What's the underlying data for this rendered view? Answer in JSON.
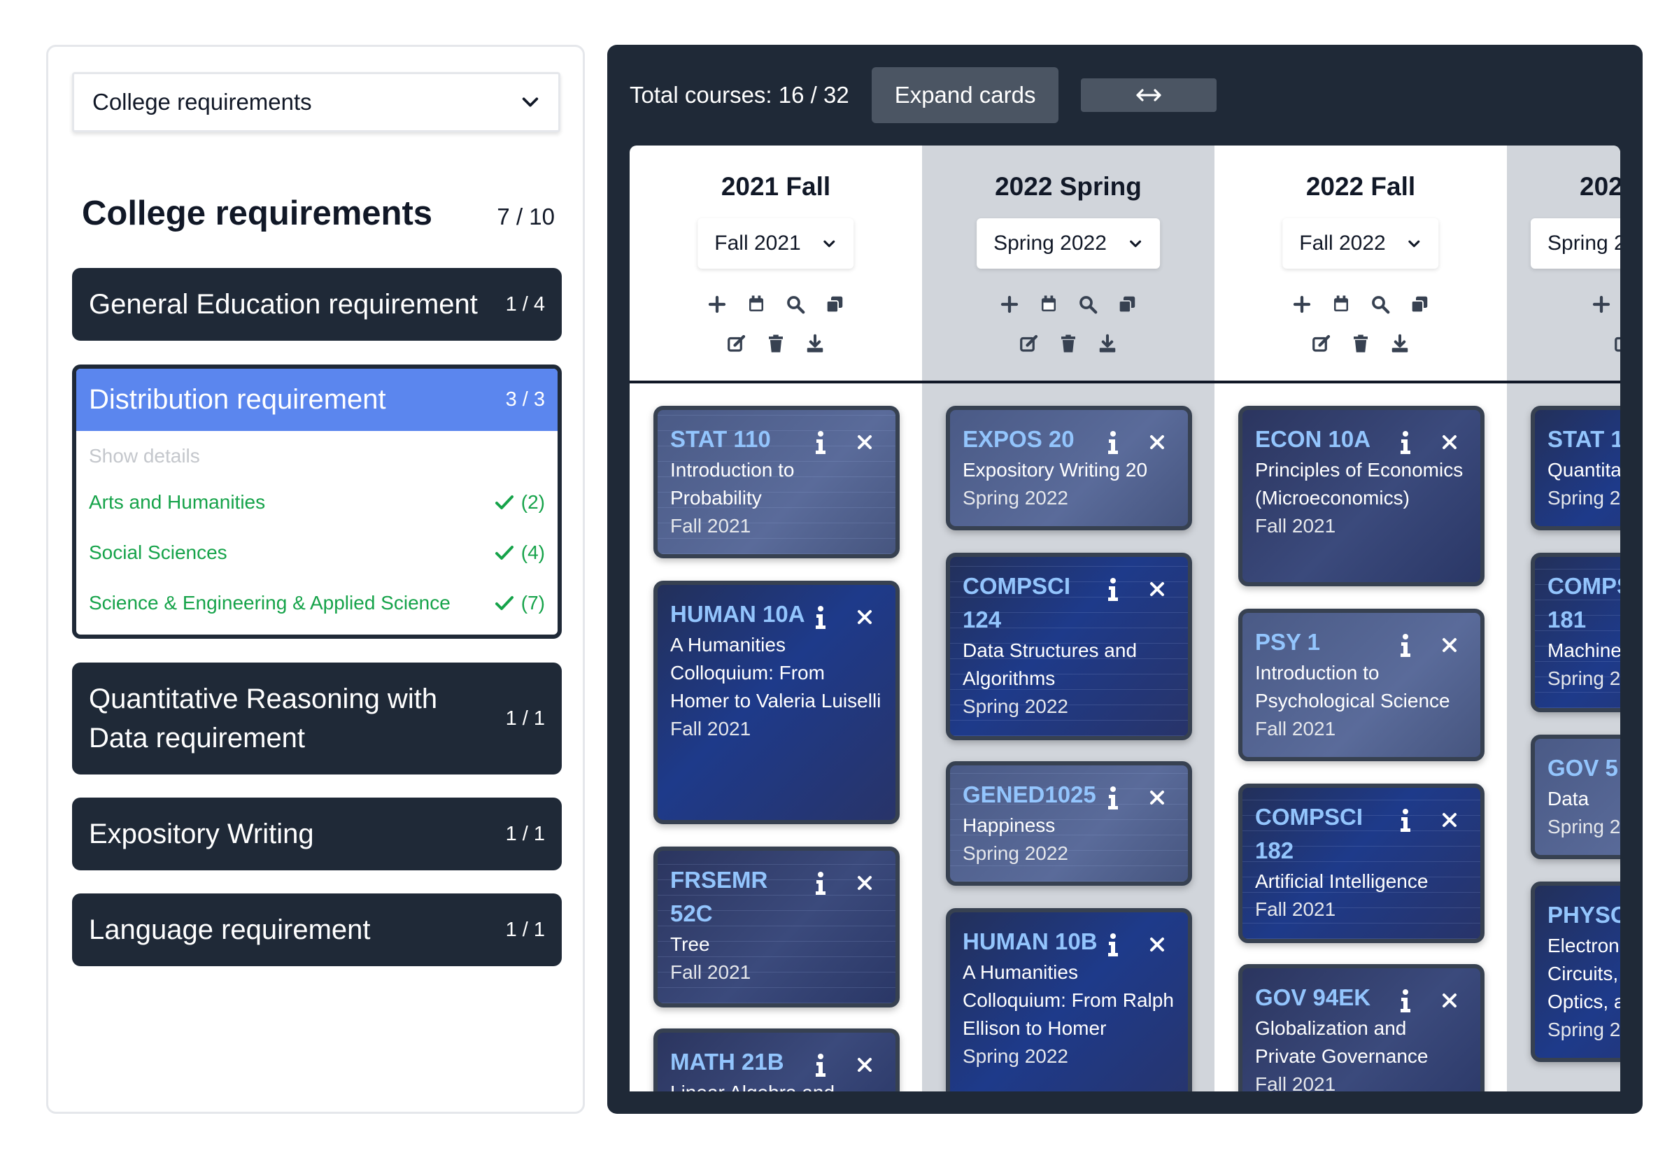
{
  "sidebar": {
    "select_label": "College requirements",
    "heading": "College requirements",
    "heading_count": "7 / 10",
    "requirements": [
      {
        "name": "General Education requirement",
        "count": "1 / 4"
      },
      {
        "name": "Distribution requirement",
        "count": "3 / 3",
        "show_details": "Show details",
        "items": [
          {
            "label": "Arts and Humanities",
            "count": "(2)"
          },
          {
            "label": "Social Sciences",
            "count": "(4)"
          },
          {
            "label": "Science & Engineering & Applied Science",
            "count": "(7)"
          }
        ]
      },
      {
        "name": "Quantitative Reasoning with Data requirement",
        "count": "1 / 1"
      },
      {
        "name": "Expository Writing",
        "count": "1 / 1"
      },
      {
        "name": "Language requirement",
        "count": "1 / 1"
      }
    ]
  },
  "toolbar": {
    "total": "Total courses: 16 / 32",
    "expand_label": "Expand cards"
  },
  "semesters": [
    {
      "title": "2021 Fall",
      "select": "Fall 2021",
      "courses": [
        {
          "code": "STAT 110",
          "name": "Introduction to Probability",
          "term": "Fall 2021"
        },
        {
          "code": "HUMAN 10A",
          "name": "A Humanities Colloquium: From Homer to Valeria Luiselli",
          "term": "Fall 2021"
        },
        {
          "code": "FRSEMR 52C",
          "name": "Tree",
          "term": "Fall 2021"
        },
        {
          "code": "MATH 21B",
          "name": "Linear Algebra and",
          "term": ""
        }
      ]
    },
    {
      "title": "2022 Spring",
      "select": "Spring 2022",
      "courses": [
        {
          "code": "EXPOS 20",
          "name": "Expository Writing 20",
          "term": "Spring 2022"
        },
        {
          "code": "COMPSCI 124",
          "name": "Data Structures and Algorithms",
          "term": "Spring 2022"
        },
        {
          "code": "GENED1025",
          "name": "Happiness",
          "term": "Spring 2022"
        },
        {
          "code": "HUMAN 10B",
          "name": "A Humanities Colloquium: From Ralph Ellison to Homer",
          "term": "Spring 2022"
        }
      ]
    },
    {
      "title": "2022 Fall",
      "select": "Fall 2022",
      "courses": [
        {
          "code": "ECON 10A",
          "name": "Principles of Economics (Microeconomics)",
          "term": "Fall 2021"
        },
        {
          "code": "PSY 1",
          "name": "Introduction to Psychological Science",
          "term": "Fall 2021"
        },
        {
          "code": "COMPSCI 182",
          "name": "Artificial Intelligence",
          "term": "Fall 2021"
        },
        {
          "code": "GOV 94EK",
          "name": "Globalization and Private Governance",
          "term": "Fall 2021"
        }
      ]
    },
    {
      "title": "202",
      "select": "Spring 2",
      "courses": [
        {
          "code": "STAT 1",
          "name": "Quantita",
          "term": "Spring 2"
        },
        {
          "code": "COMPS 181",
          "name": "Machine",
          "term": "Spring 2"
        },
        {
          "code": "GOV 5",
          "name": "Data",
          "term": "Spring 2"
        },
        {
          "code": "PHYSC",
          "name": "Electron Circuits, Optics, a",
          "term": "Spring 2"
        }
      ]
    }
  ]
}
